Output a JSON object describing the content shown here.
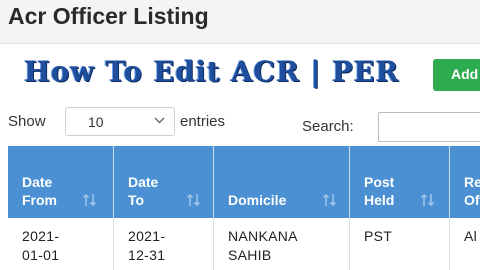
{
  "page": {
    "title": "Acr Officer Listing"
  },
  "banner": {
    "text": "How To Edit ACR | PER"
  },
  "toolbar": {
    "add_label": "Add"
  },
  "length": {
    "show_label": "Show",
    "value": "10",
    "suffix": "entries"
  },
  "search": {
    "label": "Search:",
    "value": ""
  },
  "table": {
    "columns": [
      "Date\nFrom",
      "Date\nTo",
      "Domicile",
      "Post\nHeld",
      "Re\nOf"
    ],
    "rows": [
      [
        "2021-\n01-01",
        "2021-\n12-31",
        "NANKANA\nSAHIB",
        "PST",
        "Al"
      ]
    ]
  },
  "colors": {
    "header_bg": "#4b90d2",
    "add_button": "#2eaa4f",
    "banner_text": "#1f4e9c"
  },
  "icons": {
    "sort": "sort-arrows-icon",
    "dropdown": "chevron-down-icon"
  }
}
